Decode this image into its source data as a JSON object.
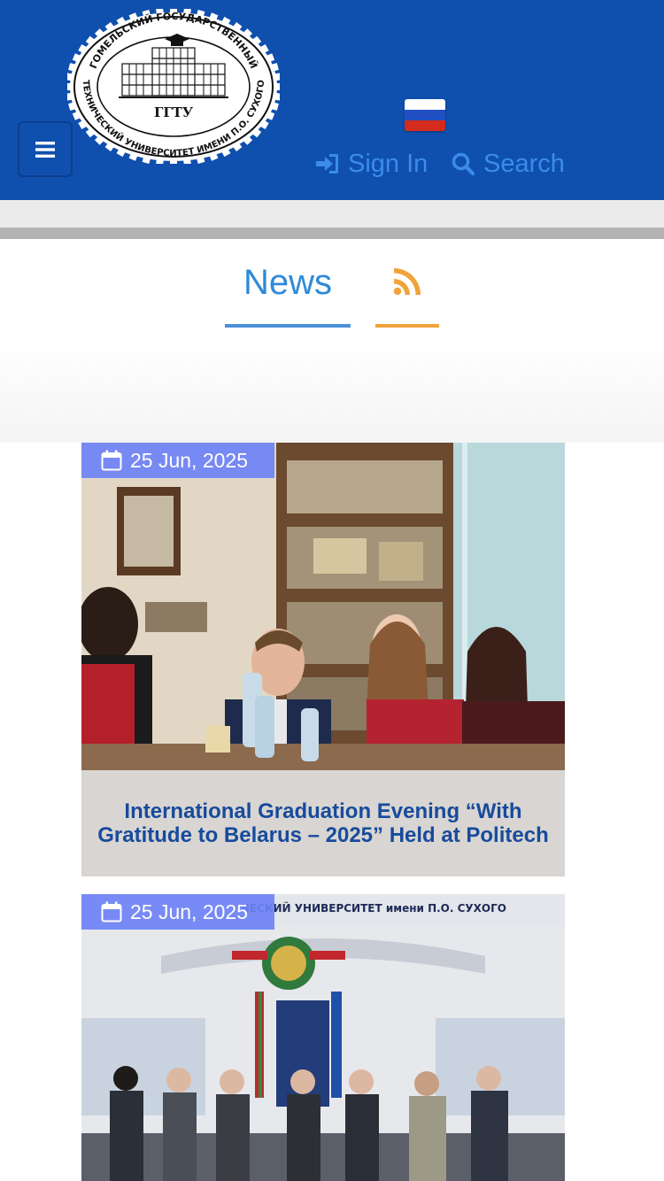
{
  "header": {
    "logo": {
      "ring_text_top": "ГОМЕЛЬСКИЙ ГОСУДАРСТВЕННЫЙ",
      "ring_text_bottom": "ТЕХНИЧЕСКИЙ УНИВЕРСИТЕТ ИМЕНИ П.О. СУХОГО",
      "center_text": "ГГТУ"
    },
    "menu_icon": "hamburger-icon",
    "language_flag": "russian-flag",
    "sign_in_label": "Sign In",
    "sign_in_icon": "sign-in-icon",
    "search_label": "Search",
    "search_icon": "search-icon",
    "colors": {
      "background": "#0f4fae",
      "link": "#3b8ce8"
    }
  },
  "section": {
    "news_tab_label": "News",
    "rss_icon": "rss-icon",
    "colors": {
      "news_underline": "#4a90d9",
      "rss": "#f0a33a"
    }
  },
  "news": [
    {
      "date": "25 Jun, 2025",
      "title": "International Graduation Evening “With Gratitude to Belarus – 2025” Held at Politech"
    },
    {
      "date": "25 Jun, 2025",
      "photo_banner_text": "ЧЕСКИЙ УНИВЕРСИТЕТ имени П.О. СУХОГО",
      "title": ""
    }
  ]
}
